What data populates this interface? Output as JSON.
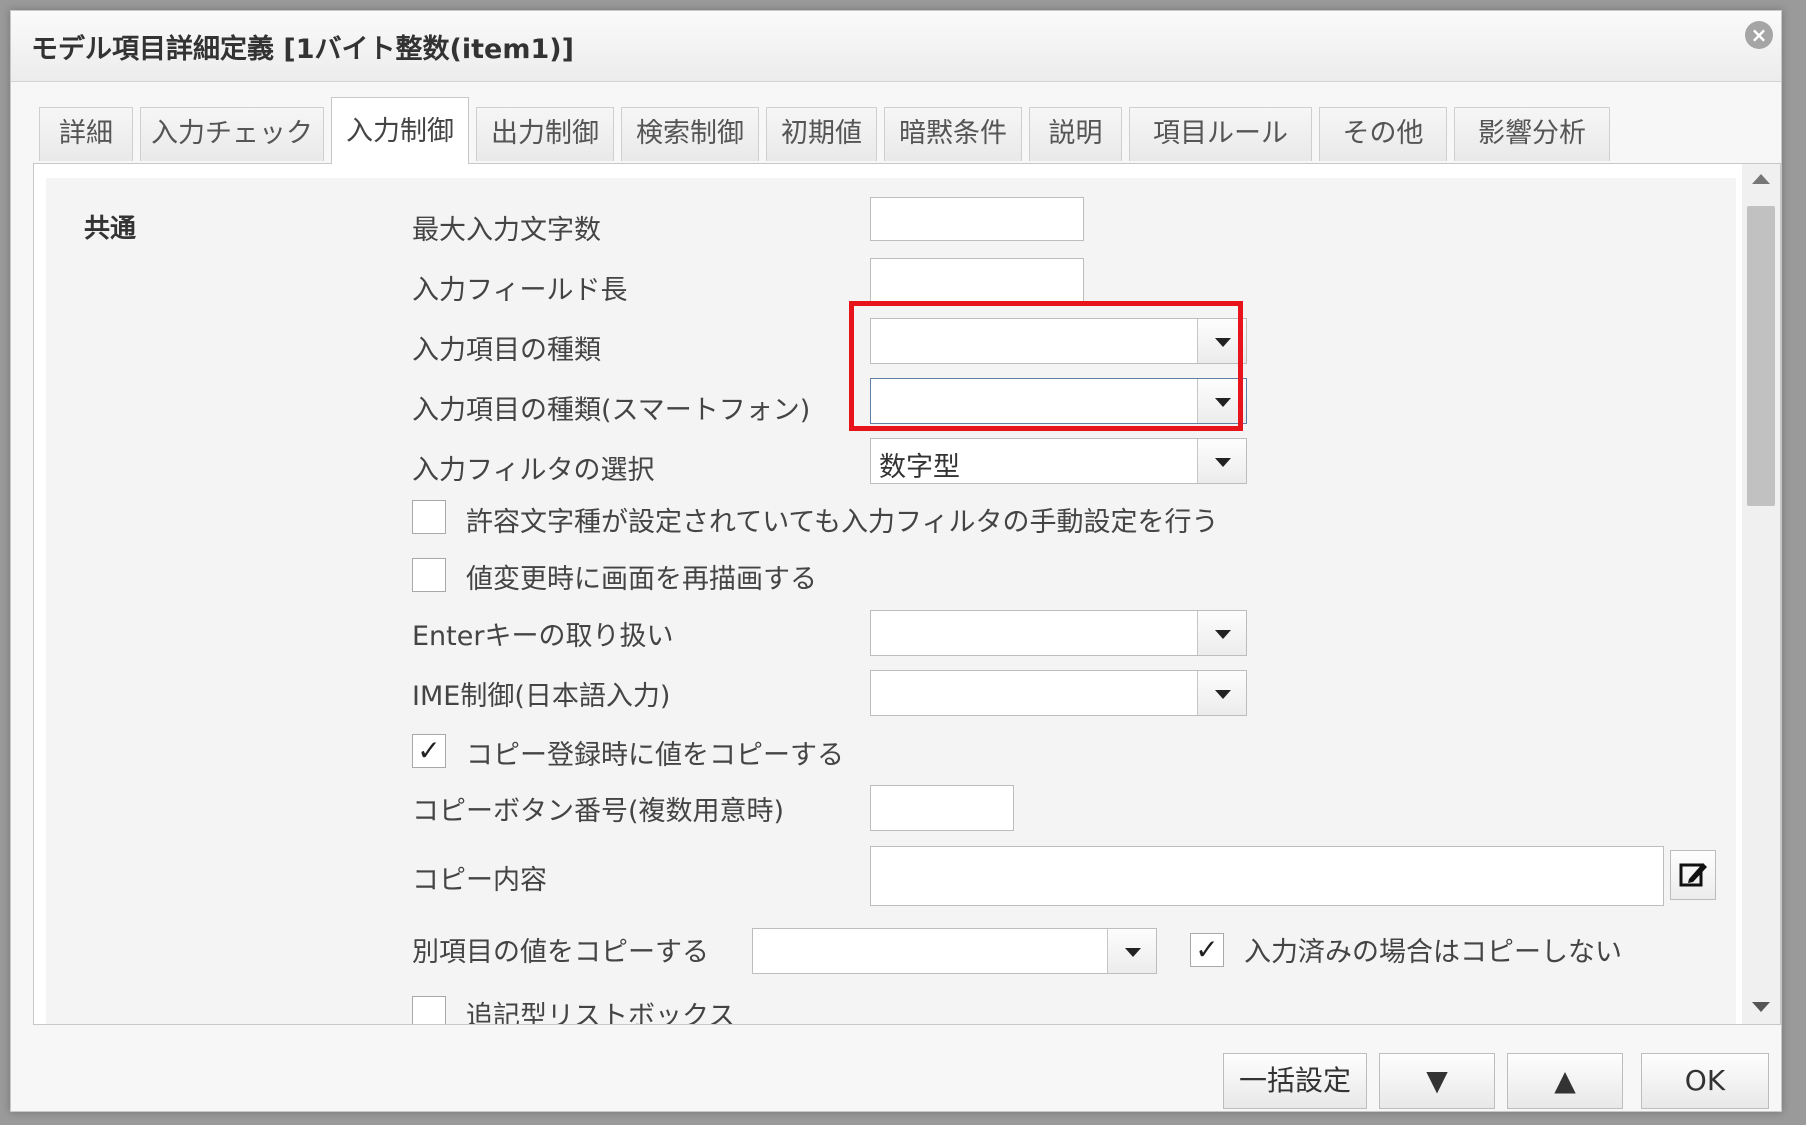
{
  "dialog": {
    "title": "モデル項目詳細定義 [1バイト整数(item1)]",
    "close_glyph": "×"
  },
  "tabs": [
    {
      "label": "詳細"
    },
    {
      "label": "入力チェック"
    },
    {
      "label": "入力制御",
      "active": true
    },
    {
      "label": "出力制御"
    },
    {
      "label": "検索制御"
    },
    {
      "label": "初期値"
    },
    {
      "label": "暗黙条件"
    },
    {
      "label": "説明"
    },
    {
      "label": "項目ルール"
    },
    {
      "label": "その他"
    },
    {
      "label": "影響分析"
    }
  ],
  "section": {
    "label": "共通"
  },
  "fields": {
    "max_input_chars": {
      "label": "最大入力文字数",
      "value": ""
    },
    "input_field_length": {
      "label": "入力フィールド長",
      "value": ""
    },
    "input_item_type": {
      "label": "入力項目の種類",
      "value": ""
    },
    "input_item_type_smartphone": {
      "label": "入力項目の種類(スマートフォン)",
      "value": ""
    },
    "input_filter": {
      "label": "入力フィルタの選択",
      "value": "数字型"
    },
    "manual_filter": {
      "label": "許容文字種が設定されていても入力フィルタの手動設定を行う",
      "checked": false
    },
    "redraw_on_change": {
      "label": "値変更時に画面を再描画する",
      "checked": false
    },
    "enter_key": {
      "label": "Enterキーの取り扱い",
      "value": ""
    },
    "ime_control": {
      "label": "IME制御(日本語入力)",
      "value": ""
    },
    "copy_on_register": {
      "label": "コピー登録時に値をコピーする",
      "checked": true,
      "check_glyph": "✓"
    },
    "copy_button_number": {
      "label": "コピーボタン番号(複数用意時)",
      "value": ""
    },
    "copy_content": {
      "label": "コピー内容",
      "value": ""
    },
    "copy_other_item": {
      "label": "別項目の値をコピーする",
      "value": ""
    },
    "skip_if_entered": {
      "label": "入力済みの場合はコピーしない",
      "checked": true,
      "check_glyph": "✓"
    },
    "append_listbox": {
      "label": "追記型リストボックス",
      "checked": false
    }
  },
  "footer": {
    "bulk_label": "一括設定",
    "down_label": "▼",
    "up_label": "▲",
    "ok_label": "OK"
  },
  "colors": {
    "highlight": "#e8141c"
  }
}
